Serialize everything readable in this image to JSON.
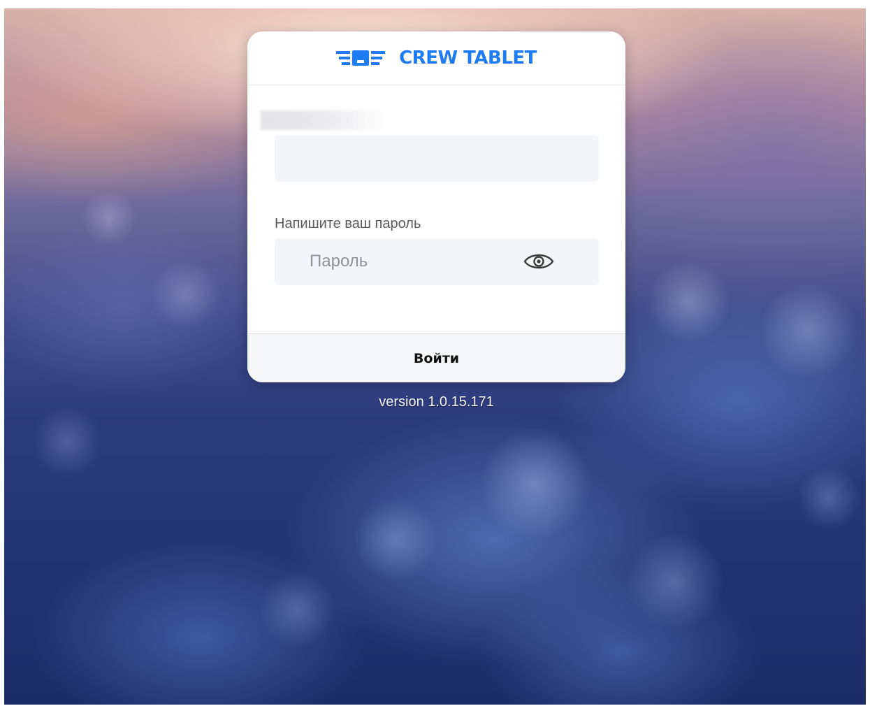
{
  "brand": {
    "name": "CREW TABLET",
    "color": "#1e7bf2"
  },
  "form": {
    "login_label": "",
    "login_value": "",
    "password_label": "Напишите ваш пароль",
    "password_placeholder": "Пароль",
    "password_toggle_icon": "eye-icon",
    "submit_label": "Войти"
  },
  "footer": {
    "version": "version 1.0.15.171"
  }
}
